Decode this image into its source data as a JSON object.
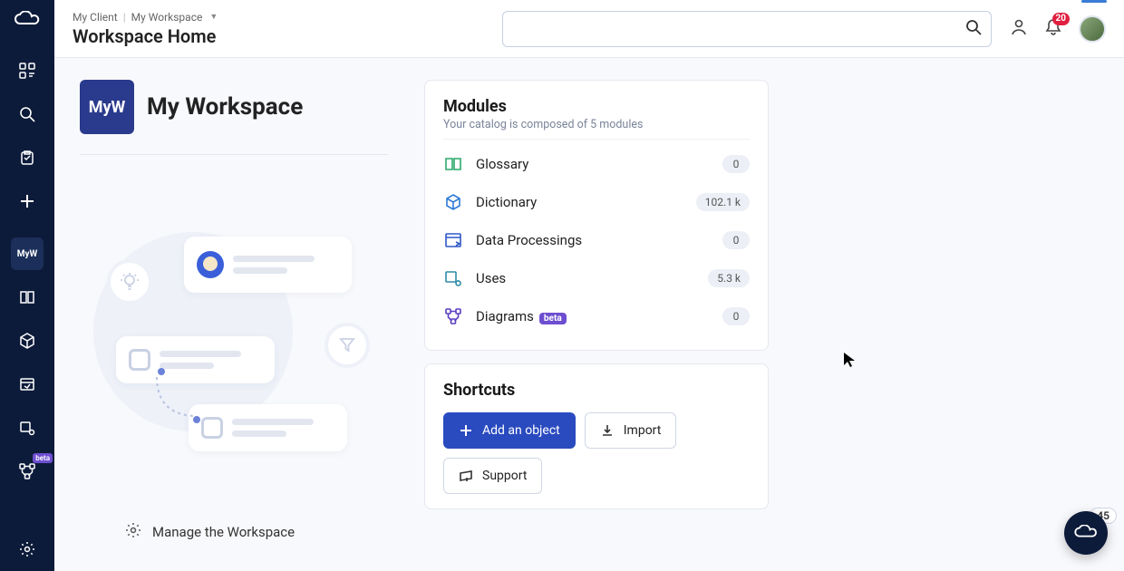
{
  "breadcrumb": {
    "client": "My Client",
    "workspace": "My Workspace"
  },
  "page_title": "Workspace Home",
  "sidebar": {
    "workspace_abbr": "MyW",
    "beta_label": "beta"
  },
  "header": {
    "search_placeholder": "",
    "notifications_count": "20"
  },
  "workspace": {
    "abbr": "MyW",
    "name": "My Workspace"
  },
  "modules_card": {
    "title": "Modules",
    "subtitle": "Your catalog is composed of 5 modules",
    "beta_label": "beta",
    "items": [
      {
        "label": "Glossary",
        "count": "0",
        "icon": "book",
        "color": "#2ba96b"
      },
      {
        "label": "Dictionary",
        "count": "102.1 k",
        "icon": "cube",
        "color": "#2e7bd6"
      },
      {
        "label": "Data Processings",
        "count": "0",
        "icon": "window",
        "color": "#2e58c9"
      },
      {
        "label": "Uses",
        "count": "5.3 k",
        "icon": "uses",
        "color": "#2e8ba8"
      },
      {
        "label": "Diagrams",
        "count": "0",
        "icon": "diagram",
        "color": "#5a3fc0",
        "beta": true
      }
    ]
  },
  "shortcuts_card": {
    "title": "Shortcuts",
    "add_label": "Add an object",
    "import_label": "Import",
    "support_label": "Support"
  },
  "manage_link": "Manage the Workspace",
  "float_count": "45"
}
